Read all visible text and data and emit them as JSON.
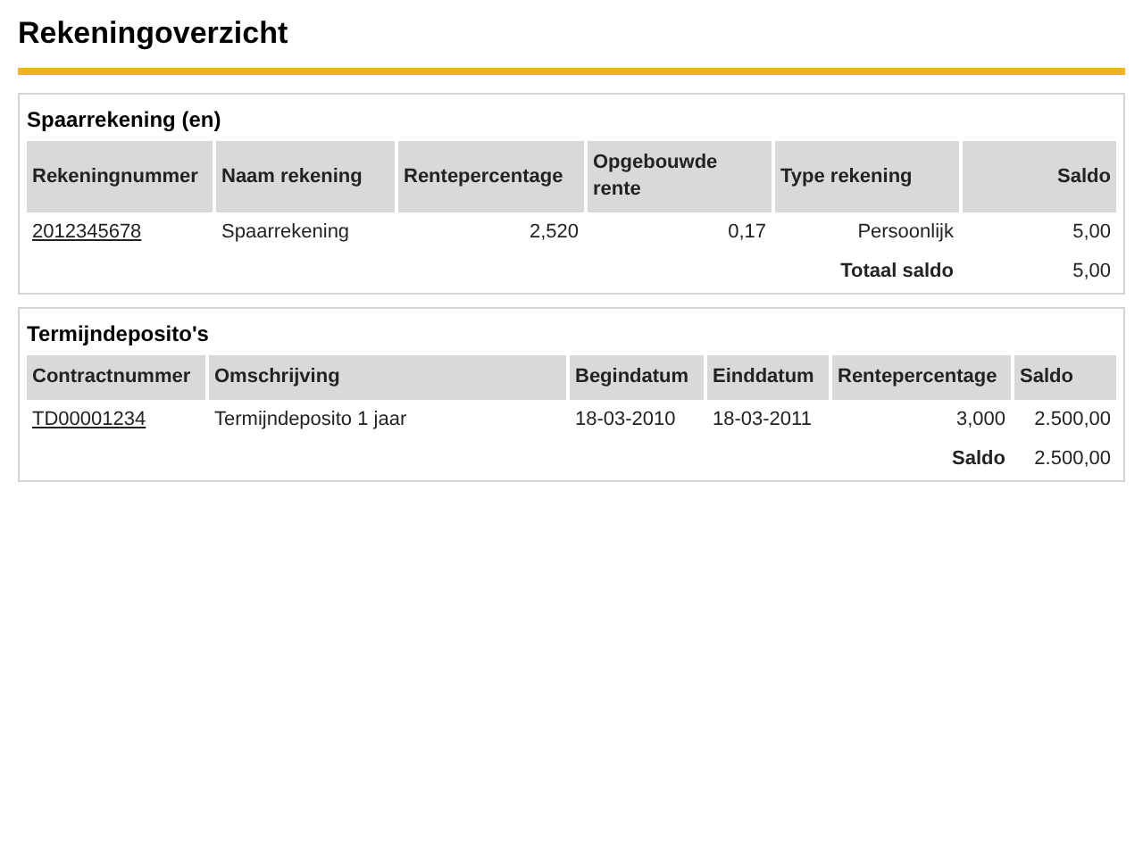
{
  "title": "Rekeningoverzicht",
  "sections": [
    {
      "title": "Spaarrekening (en)",
      "columns": [
        "Rekeningnummer",
        "Naam rekening",
        "Rentepercentage",
        "Opgebouwde rente",
        "Type rekening",
        "Saldo"
      ],
      "rows": [
        {
          "cells": [
            {
              "text": "2012345678",
              "kind": "link"
            },
            {
              "text": "Spaarrekening",
              "kind": "text"
            },
            {
              "text": "2,520",
              "kind": "text"
            },
            {
              "text": "0,17",
              "kind": "text"
            },
            {
              "text": "Persoonlijk",
              "kind": "text"
            },
            {
              "text": "5,00",
              "kind": "text"
            }
          ]
        }
      ],
      "total": {
        "label": "Totaal saldo",
        "value": "5,00"
      }
    },
    {
      "title": "Termijndeposito's",
      "columns": [
        "Contractnummer",
        "Omschrijving",
        "Begindatum",
        "Einddatum",
        "Rentepercentage",
        "Saldo"
      ],
      "rows": [
        {
          "cells": [
            {
              "text": "TD00001234",
              "kind": "link"
            },
            {
              "text": "Termijndeposito 1 jaar",
              "kind": "text"
            },
            {
              "text": "18-03-2010",
              "kind": "text"
            },
            {
              "text": "18-03-2011",
              "kind": "text"
            },
            {
              "text": "3,000",
              "kind": "text"
            },
            {
              "text": "2.500,00",
              "kind": "text"
            }
          ]
        }
      ],
      "total": {
        "label": "Saldo",
        "value": "2.500,00"
      }
    }
  ]
}
